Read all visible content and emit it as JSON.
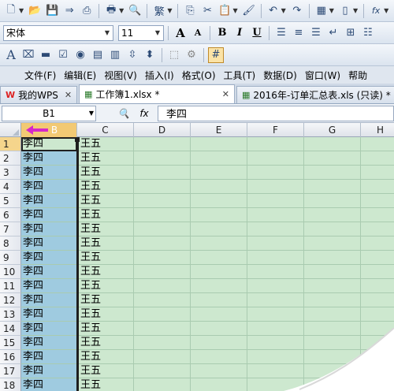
{
  "toolbar1": {
    "icons": [
      "new-icon",
      "open-icon",
      "save-icon",
      "save-as-icon",
      "pdf-icon",
      "print-icon",
      "print-preview-icon",
      "traditional-chinese-icon",
      "copy-icon",
      "cut-icon",
      "paste-icon",
      "format-painter-icon",
      "undo-icon",
      "redo-icon",
      "table-icon",
      "column-icon",
      "formula-icon"
    ],
    "trad_label": "繁",
    "formula_label": "fx"
  },
  "toolbar2": {
    "font_name": "宋体",
    "font_size": "11",
    "grow_font": "A",
    "shrink_font": "A",
    "bold": "B",
    "italic": "I",
    "underline": "U"
  },
  "menu": {
    "items": [
      "文件(F)",
      "编辑(E)",
      "视图(V)",
      "插入(I)",
      "格式(O)",
      "工具(T)",
      "数据(D)",
      "窗口(W)",
      "帮助"
    ]
  },
  "tabs": [
    {
      "label": "我的WPS",
      "icon": "wps-icon",
      "active": false
    },
    {
      "label": "工作簿1.xlsx *",
      "icon": "sheet-icon",
      "active": true
    },
    {
      "label": "2016年-订单汇总表.xls (只读) *",
      "icon": "sheet-icon",
      "active": false
    }
  ],
  "formula_bar": {
    "name_box": "B1",
    "fx_label": "fx",
    "value": "李四"
  },
  "columns": [
    "B",
    "C",
    "D",
    "E",
    "F",
    "G",
    "H"
  ],
  "rows": [
    {
      "n": "1",
      "b": "李四",
      "c": "王五"
    },
    {
      "n": "2",
      "b": "李四",
      "c": "王五"
    },
    {
      "n": "3",
      "b": "李四",
      "c": "王五"
    },
    {
      "n": "4",
      "b": "李四",
      "c": "王五"
    },
    {
      "n": "5",
      "b": "李四",
      "c": "王五"
    },
    {
      "n": "6",
      "b": "李四",
      "c": "王五"
    },
    {
      "n": "7",
      "b": "李四",
      "c": "王五"
    },
    {
      "n": "8",
      "b": "李四",
      "c": "王五"
    },
    {
      "n": "9",
      "b": "李四",
      "c": "王五"
    },
    {
      "n": "10",
      "b": "李四",
      "c": "王五"
    },
    {
      "n": "11",
      "b": "李四",
      "c": "王五"
    },
    {
      "n": "12",
      "b": "李四",
      "c": "王五"
    },
    {
      "n": "13",
      "b": "李四",
      "c": "王五"
    },
    {
      "n": "14",
      "b": "李四",
      "c": "王五"
    },
    {
      "n": "15",
      "b": "李四",
      "c": "王五"
    },
    {
      "n": "16",
      "b": "李四",
      "c": "王五"
    },
    {
      "n": "17",
      "b": "李四",
      "c": "王五"
    },
    {
      "n": "18",
      "b": "李四",
      "c": "王五"
    }
  ],
  "colors": {
    "grid_bg": "#cde8cf",
    "selected_col": "#9fcbe0",
    "drag_arrow": "#d627c9"
  }
}
